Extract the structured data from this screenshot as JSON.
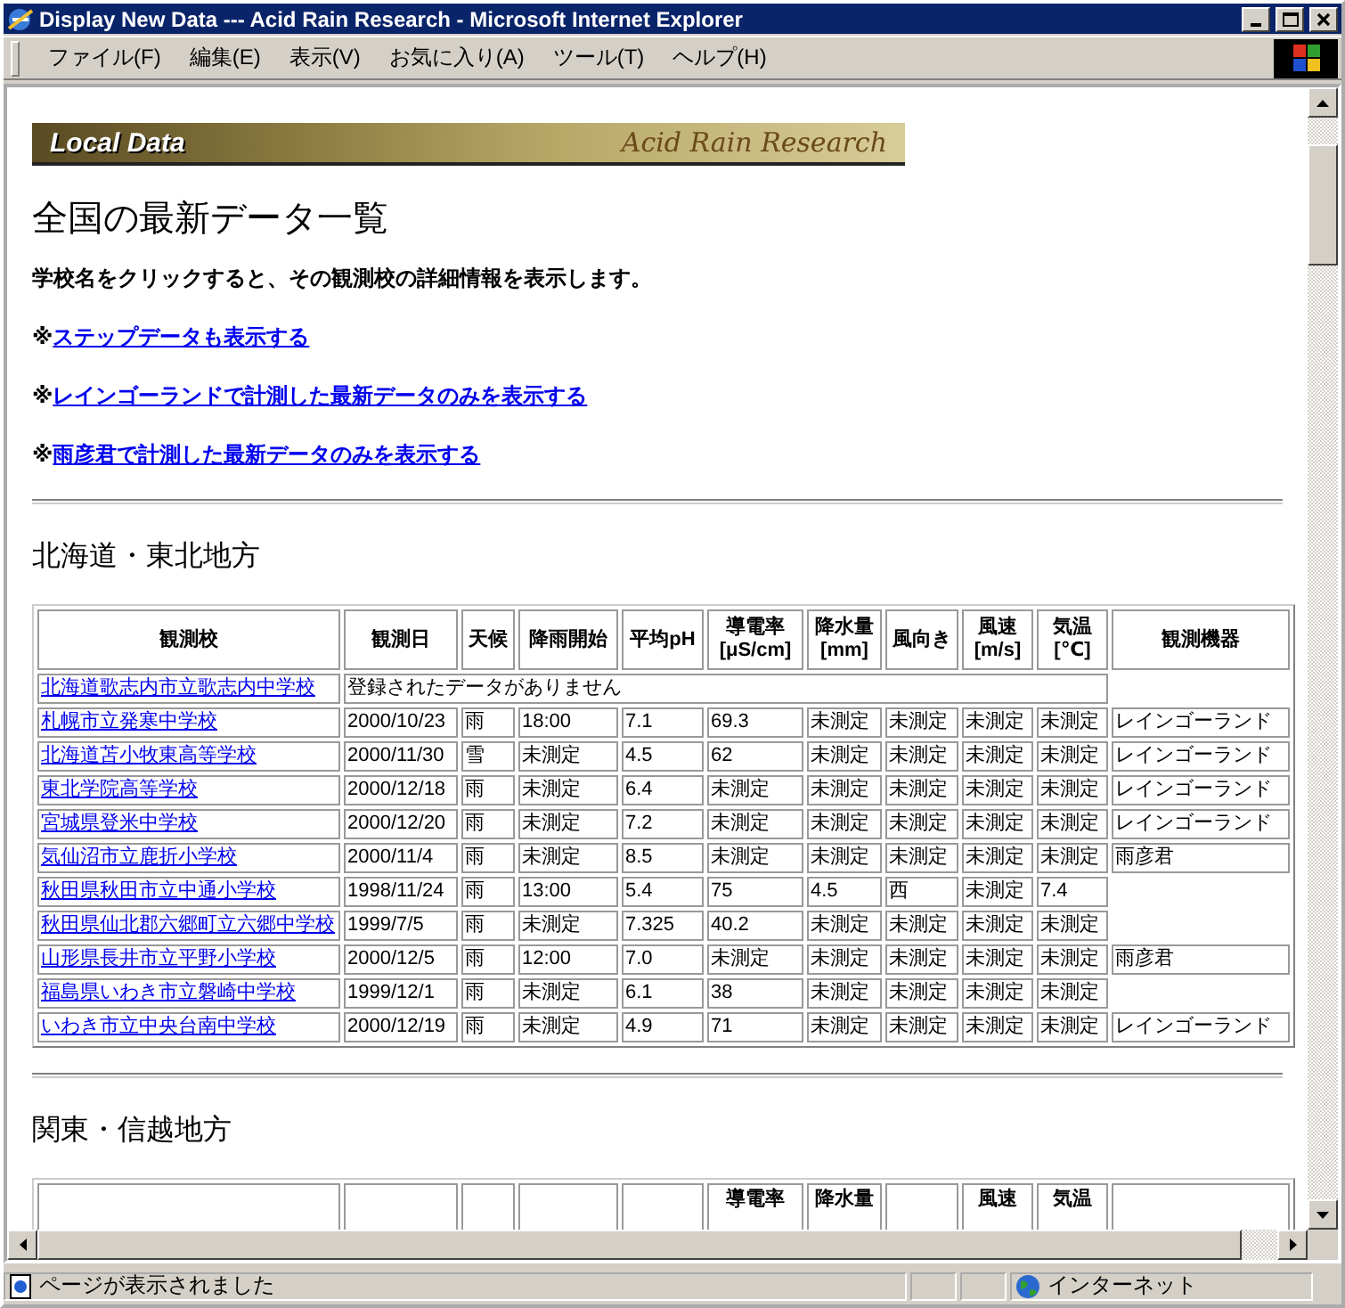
{
  "window": {
    "title": "Display New Data --- Acid Rain Research - Microsoft Internet Explorer"
  },
  "menu": [
    "ファイル(F)",
    "編集(E)",
    "表示(V)",
    "お気に入り(A)",
    "ツール(T)",
    "ヘルプ(H)"
  ],
  "banner": {
    "left": "Local Data",
    "right": "Acid Rain Research"
  },
  "heading": "全国の最新データ一覧",
  "intro": "学校名をクリックすると、その観測校の詳細情報を表示します。",
  "options": [
    {
      "mark": "※",
      "link": "ステップデータも表示する"
    },
    {
      "mark": "※",
      "link": "レインゴーランドで計測した最新データのみを表示する"
    },
    {
      "mark": "※",
      "link": "雨彦君で計測した最新データのみを表示する"
    }
  ],
  "sections": [
    {
      "title": "北海道・東北地方",
      "table": {
        "columns": [
          {
            "label": "観測校"
          },
          {
            "label": "観測日"
          },
          {
            "label": "天候"
          },
          {
            "label": "降雨開始"
          },
          {
            "label": "平均pH"
          },
          {
            "label": "導電率\n[μS/cm]"
          },
          {
            "label": "降水量\n[mm]"
          },
          {
            "label": "風向き"
          },
          {
            "label": "風速\n[m/s]"
          },
          {
            "label": "気温\n[℃]"
          },
          {
            "label": "観測機器"
          }
        ],
        "rows": [
          {
            "school": "北海道歌志内市立歌志内中学校",
            "message": "登録されたデータがありません"
          },
          {
            "school": "札幌市立発寒中学校",
            "cells": [
              "2000/10/23",
              "雨",
              "18:00",
              "7.1",
              "69.3",
              "未測定",
              "未測定",
              "未測定",
              "未測定"
            ],
            "instrument": "レインゴーランド"
          },
          {
            "school": "北海道苫小牧東高等学校",
            "cells": [
              "2000/11/30",
              "雪",
              "未測定",
              "4.5",
              "62",
              "未測定",
              "未測定",
              "未測定",
              "未測定"
            ],
            "instrument": "レインゴーランド"
          },
          {
            "school": "東北学院高等学校",
            "cells": [
              "2000/12/18",
              "雨",
              "未測定",
              "6.4",
              "未測定",
              "未測定",
              "未測定",
              "未測定",
              "未測定"
            ],
            "instrument": "レインゴーランド"
          },
          {
            "school": "宮城県登米中学校",
            "cells": [
              "2000/12/20",
              "雨",
              "未測定",
              "7.2",
              "未測定",
              "未測定",
              "未測定",
              "未測定",
              "未測定"
            ],
            "instrument": "レインゴーランド"
          },
          {
            "school": "気仙沼市立鹿折小学校",
            "cells": [
              "2000/11/4",
              "雨",
              "未測定",
              "8.5",
              "未測定",
              "未測定",
              "未測定",
              "未測定",
              "未測定"
            ],
            "instrument": "雨彦君"
          },
          {
            "school": "秋田県秋田市立中通小学校",
            "cells": [
              "1998/11/24",
              "雨",
              "13:00",
              "5.4",
              "75",
              "4.5",
              "西",
              "未測定",
              "7.4"
            ]
          },
          {
            "school": "秋田県仙北郡六郷町立六郷中学校",
            "cells": [
              "1999/7/5",
              "雨",
              "未測定",
              "7.325",
              "40.2",
              "未測定",
              "未測定",
              "未測定",
              "未測定"
            ]
          },
          {
            "school": "山形県長井市立平野小学校",
            "cells": [
              "2000/12/5",
              "雨",
              "12:00",
              "7.0",
              "未測定",
              "未測定",
              "未測定",
              "未測定",
              "未測定"
            ],
            "instrument": "雨彦君"
          },
          {
            "school": "福島県いわき市立磐崎中学校",
            "cells": [
              "1999/12/1",
              "雨",
              "未測定",
              "6.1",
              "38",
              "未測定",
              "未測定",
              "未測定",
              "未測定"
            ]
          },
          {
            "school": "いわき市立中央台南中学校",
            "cells": [
              "2000/12/19",
              "雨",
              "未測定",
              "4.9",
              "71",
              "未測定",
              "未測定",
              "未測定",
              "未測定"
            ],
            "instrument": "レインゴーランド"
          }
        ]
      }
    },
    {
      "title": "関東・信越地方",
      "table": {
        "columns": [
          {
            "kind": "cut"
          },
          {
            "kind": "cut"
          },
          {
            "kind": "cut"
          },
          {
            "kind": "cut"
          },
          {
            "kind": "cut"
          },
          {
            "kind": "text",
            "label": "導電率"
          },
          {
            "kind": "text",
            "label": "降水量"
          },
          {
            "kind": "cut"
          },
          {
            "kind": "text",
            "label": "風速"
          },
          {
            "kind": "text",
            "label": "気温"
          },
          {
            "kind": "cut"
          }
        ]
      }
    }
  ],
  "status_bar": {
    "text": "ページが表示されました",
    "zone": "インターネット"
  }
}
